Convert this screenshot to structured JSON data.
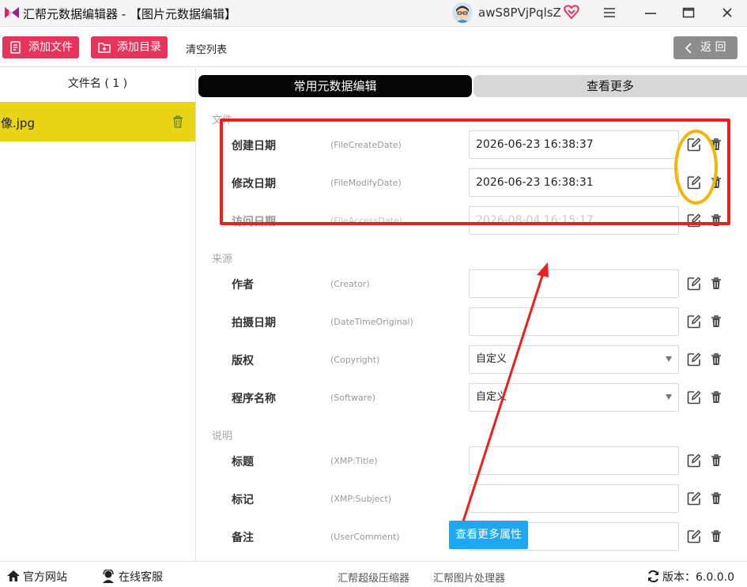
{
  "window": {
    "title": "汇帮元数据编辑器 - 【图片元数据编辑】",
    "username": "awS8PVjPqlsZ"
  },
  "toolbar": {
    "add_file": "添加文件",
    "add_folder": "添加目录",
    "clear_list": "清空列表",
    "back": "返 回"
  },
  "file_list": {
    "header": "文件名 ( 1 )",
    "items": [
      {
        "name": "头像.jpg"
      }
    ]
  },
  "tabs": {
    "common": "常用元数据编辑",
    "more": "查看更多"
  },
  "sections": {
    "file": {
      "title": "文件",
      "rows": [
        {
          "label": "创建日期",
          "key": "(FileCreateDate)",
          "value": "2026-06-23 16:38:37"
        },
        {
          "label": "修改日期",
          "key": "(FileModifyDate)",
          "value": "2026-06-23 16:38:31"
        },
        {
          "label": "访问日期",
          "key": "(FileAccessDate)",
          "value": "2026-08-04 16:15:17"
        }
      ]
    },
    "source": {
      "title": "来源",
      "rows": [
        {
          "label": "作者",
          "key": "(Creator)",
          "value": ""
        },
        {
          "label": "拍摄日期",
          "key": "(DateTimeOriginal)",
          "value": ""
        },
        {
          "label": "版权",
          "key": "(Copyright)",
          "value": "自定义"
        },
        {
          "label": "程序名称",
          "key": "(Software)",
          "value": "自定义"
        }
      ]
    },
    "description": {
      "title": "说明",
      "rows": [
        {
          "label": "标题",
          "key": "(XMP:Title)",
          "value": ""
        },
        {
          "label": "标记",
          "key": "(XMP:Subject)",
          "value": ""
        },
        {
          "label": "备注",
          "key": "(UserComment)",
          "value": ""
        }
      ]
    }
  },
  "more_button": "查看更多属性",
  "statusbar": {
    "official_site": "官方网站",
    "online_service": "在线客服",
    "compressor": "汇帮超级压缩器",
    "image_processor": "汇帮图片处理器",
    "version": "版本：6.0.0.0"
  },
  "colors": {
    "accent": "#e8335a",
    "selected_file": "#e9d415",
    "annotation_red": "#ec1e1e",
    "annotation_yellow": "#f5b400",
    "more_button": "#1ea7f3"
  }
}
